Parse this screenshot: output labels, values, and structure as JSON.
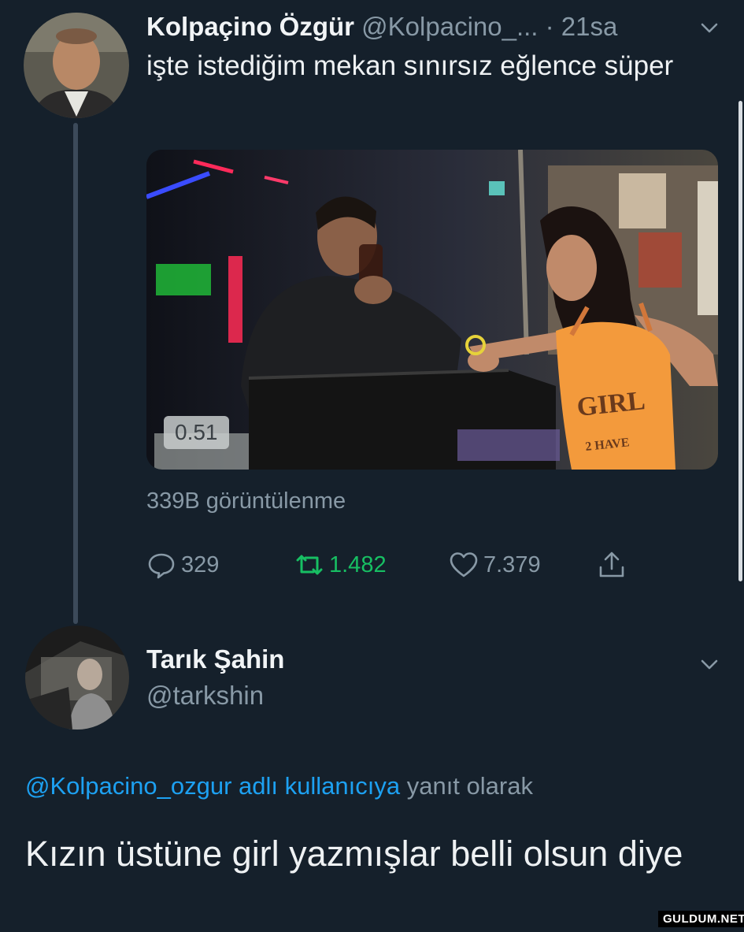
{
  "tweet": {
    "author_name": "Kolpaçino Özgür",
    "author_handle": "@Kolpacino_...",
    "time": "· 21sa",
    "text": "işte istediğim mekan sınırsız eğlence süper",
    "video": {
      "duration": "0.51",
      "shirt_text_1": "GIRL",
      "shirt_text_2": "2 HAVE"
    },
    "views": "339B görüntülenme",
    "stats": {
      "replies": "329",
      "retweets": "1.482",
      "likes": "7.379"
    }
  },
  "reply": {
    "author_name": "Tarık Şahin",
    "author_handle": "@tarkshin",
    "replying_to_link": "@Kolpacino_ozgur adlı kullanıcıya",
    "replying_to_suffix": " yanıt olarak",
    "text": "Kızın üstüne girl yazmışlar belli olsun diye"
  },
  "watermark": "GULDUM.NET",
  "icons": {
    "reply": "speech-bubble-icon",
    "retweet": "retweet-icon",
    "like": "heart-icon",
    "share": "share-icon",
    "caret": "chevron-down-icon"
  },
  "colors": {
    "background": "#15202b",
    "secondary_text": "#8899a6",
    "link": "#1da1f2",
    "retweet_active": "#17bf63"
  }
}
